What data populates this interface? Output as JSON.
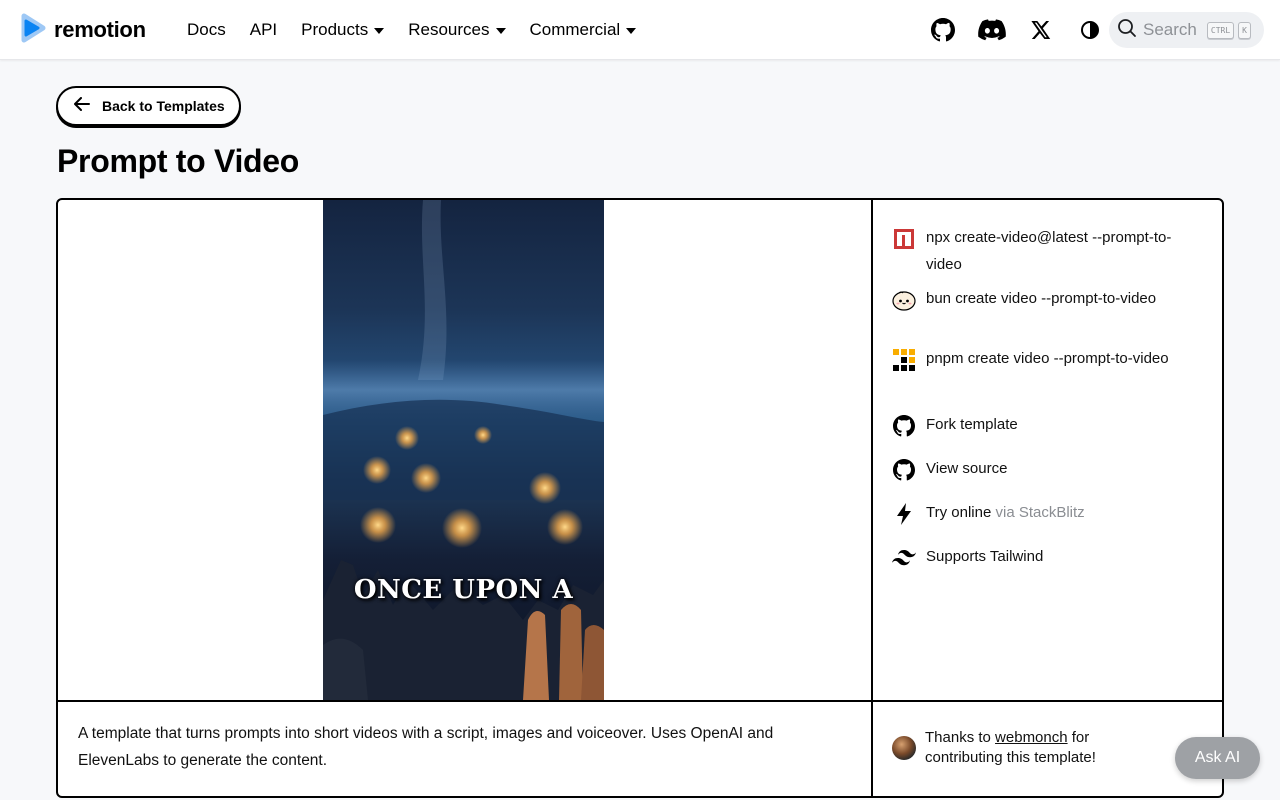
{
  "navbar": {
    "brand": "remotion",
    "links": [
      {
        "label": "Docs"
      },
      {
        "label": "API"
      },
      {
        "label": "Products"
      },
      {
        "label": "Resources"
      },
      {
        "label": "Commercial"
      }
    ],
    "icons": [
      "github-icon",
      "discord-icon",
      "x-icon",
      "theme-toggle-icon"
    ],
    "search": {
      "placeholder": "Search",
      "kbd_ctrl": "CTRL",
      "kbd_key": "K"
    }
  },
  "back_button": {
    "label": "Back to Templates"
  },
  "page_title": "Prompt to Video",
  "video": {
    "caption": "ONCE UPON A"
  },
  "install_options": [
    {
      "icon": "npm-icon",
      "text": "npx create-video@latest --prompt-to-video"
    },
    {
      "icon": "bun-icon",
      "text": "bun create video --prompt-to-video"
    },
    {
      "icon": "pnpm-icon",
      "text": "pnpm create video --prompt-to-video"
    },
    {
      "icon": "github-icon",
      "text": "Fork template"
    },
    {
      "icon": "github-icon",
      "text": "View source"
    },
    {
      "icon": "bolt-icon",
      "text": "Try online",
      "suffix": "via StackBlitz"
    },
    {
      "icon": "tailwind-icon",
      "text": "Supports Tailwind"
    }
  ],
  "description": "A template that turns prompts into short videos with a script, images and voiceover. Uses OpenAI and ElevenLabs to generate the content.",
  "credits": {
    "prefix": "Thanks to",
    "author": "webmonch",
    "suffix": "for contributing this template!"
  },
  "ask_ai": {
    "label": "Ask AI"
  },
  "colors": {
    "brand_blue": "#0b84f3",
    "npm_red": "#cb3837",
    "pnpm_yellow": "#f9ad00"
  }
}
